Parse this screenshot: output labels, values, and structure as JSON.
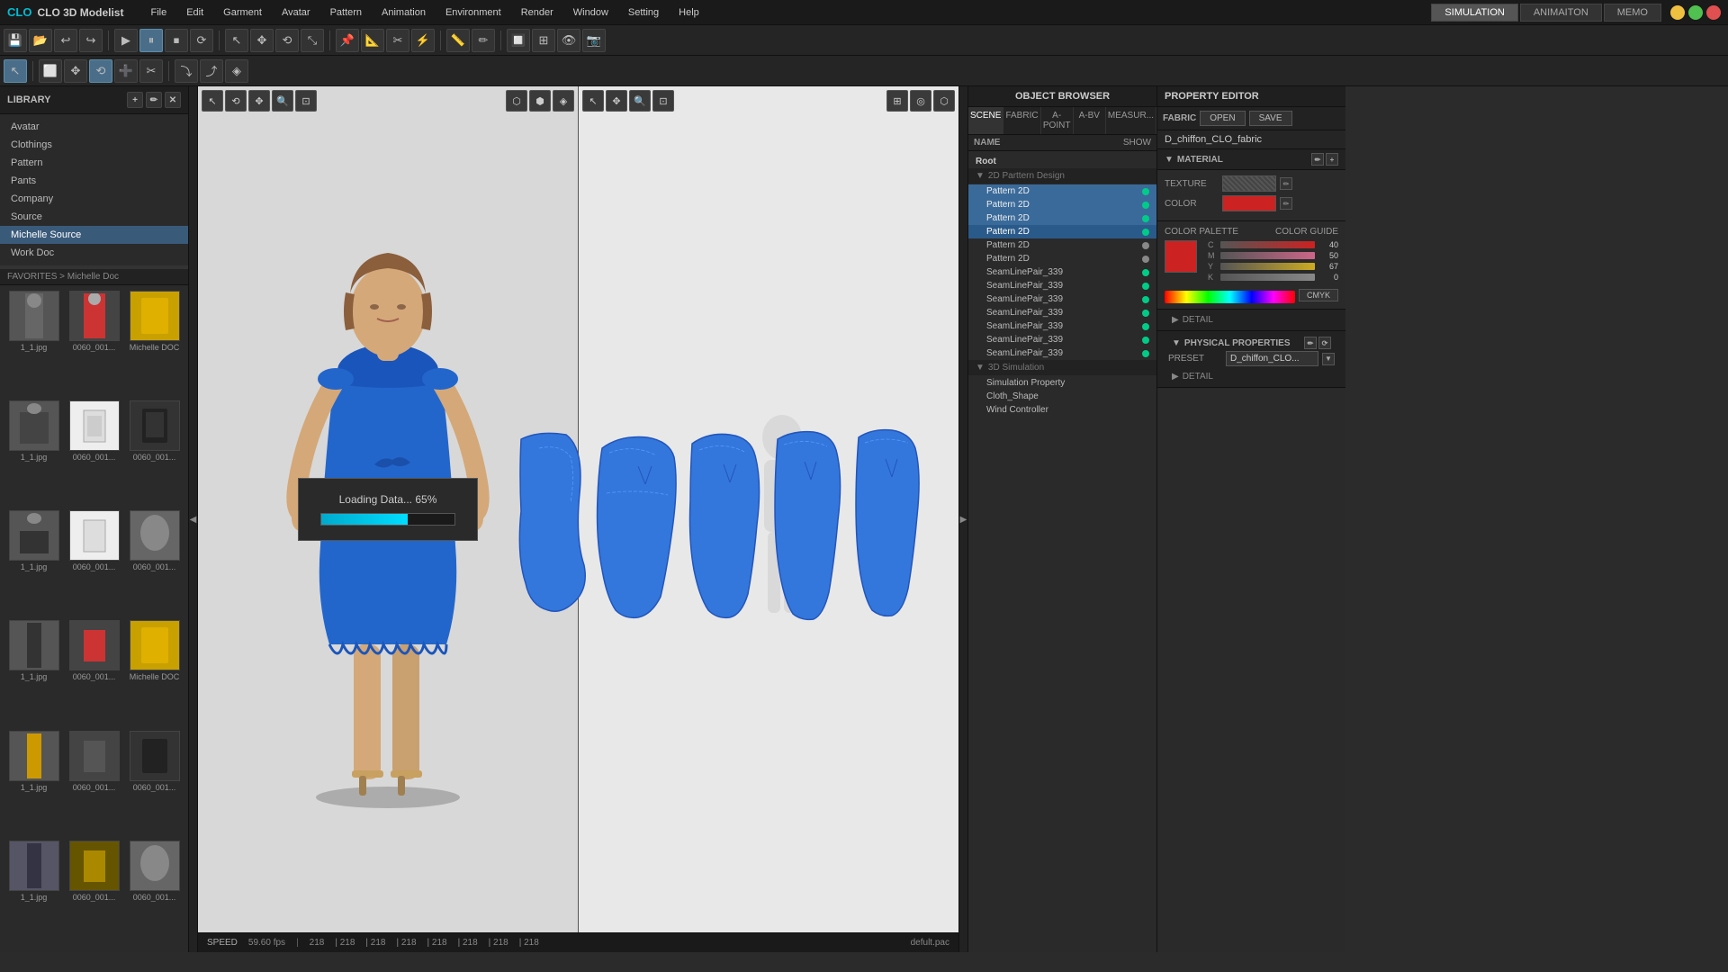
{
  "app": {
    "title": "CLO 3D Modelist",
    "logo": "CLO 3D Modelist"
  },
  "menu": {
    "items": [
      "File",
      "Edit",
      "Garment",
      "Avatar",
      "Pattern",
      "Animation",
      "Environment",
      "Render",
      "Window",
      "Setting",
      "Help"
    ]
  },
  "modes": {
    "simulation": "SIMULATION",
    "animation": "ANIMAITON",
    "memo": "MEMO"
  },
  "library": {
    "header": "LIBRARY",
    "nav_items": [
      "Avatar",
      "Clothings",
      "Pattern",
      "Pants",
      "Company",
      "Source",
      "Michelle Source",
      "Work Doc"
    ],
    "selected_item": "Michelle Source",
    "breadcrumb": "FAVORITES > Michelle Doc",
    "grid_items": [
      {
        "label": "1_1.jpg"
      },
      {
        "label": "0060_001..."
      },
      {
        "label": "Michelle DOC"
      },
      {
        "label": "1_1.jpg"
      },
      {
        "label": "0060_001..."
      },
      {
        "label": "0060_001..."
      },
      {
        "label": "1_1.jpg"
      },
      {
        "label": "0060_001..."
      },
      {
        "label": "0060_001..."
      },
      {
        "label": "1_1.jpg"
      },
      {
        "label": "0060_001..."
      },
      {
        "label": "Michelle DOC"
      },
      {
        "label": "1_1.jpg"
      },
      {
        "label": "0060_001..."
      },
      {
        "label": "0060_001..."
      },
      {
        "label": "1_1.jpg"
      },
      {
        "label": "0060_001..."
      },
      {
        "label": "0060_001..."
      }
    ]
  },
  "loading": {
    "text": "Loading Data... 65%",
    "progress": 65
  },
  "status_bar": {
    "speed_label": "SPEED",
    "speed_value": "59.60 fps",
    "coords": [
      "218",
      "218",
      "218",
      "218",
      "218",
      "218",
      "218",
      "218"
    ],
    "pac_name": "defult.pac"
  },
  "object_browser": {
    "header": "OBJECT BROWSER",
    "tabs": [
      "SCENE",
      "FABRIC",
      "A-POINT",
      "A-BV",
      "MEASUR..."
    ],
    "name_label": "NAME",
    "show_label": "SHOW",
    "tree": [
      {
        "label": "Root",
        "indent": 0,
        "type": "root"
      },
      {
        "label": "2D Parttern Design",
        "indent": 1,
        "type": "section"
      },
      {
        "label": "Pattern 2D",
        "indent": 2,
        "type": "item",
        "selected": true,
        "dot": true
      },
      {
        "label": "Pattern 2D",
        "indent": 2,
        "type": "item",
        "selected": true,
        "dot": true
      },
      {
        "label": "Pattern 2D",
        "indent": 2,
        "type": "item",
        "selected": true,
        "dot": true
      },
      {
        "label": "Pattern 2D",
        "indent": 2,
        "type": "item",
        "selected": true,
        "dot": true
      },
      {
        "label": "Pattern 2D",
        "indent": 2,
        "type": "item",
        "dot": false
      },
      {
        "label": "Pattern 2D",
        "indent": 2,
        "type": "item",
        "dot": false
      },
      {
        "label": "SeamLinePair_339",
        "indent": 2,
        "type": "item",
        "dot": true
      },
      {
        "label": "SeamLinePair_339",
        "indent": 2,
        "type": "item",
        "dot": true
      },
      {
        "label": "SeamLinePair_339",
        "indent": 2,
        "type": "item",
        "dot": true
      },
      {
        "label": "SeamLinePair_339",
        "indent": 2,
        "type": "item",
        "dot": true
      },
      {
        "label": "SeamLinePair_339",
        "indent": 2,
        "type": "item",
        "dot": true
      },
      {
        "label": "SeamLinePair_339",
        "indent": 2,
        "type": "item",
        "dot": true
      },
      {
        "label": "SeamLinePair_339",
        "indent": 2,
        "type": "item",
        "dot": true
      },
      {
        "label": "3D Simulation",
        "indent": 1,
        "type": "section"
      },
      {
        "label": "Simulation Property",
        "indent": 2,
        "type": "item"
      },
      {
        "label": "Cloth_Shape",
        "indent": 2,
        "type": "item"
      },
      {
        "label": "Wind Controller",
        "indent": 2,
        "type": "item"
      }
    ]
  },
  "property_editor": {
    "header": "PROPERTY EDITOR",
    "open_label": "OPEN",
    "save_label": "SAVE",
    "fabric_section": "FABRIC",
    "fabric_name": "D_chiffon_CLO_fabric",
    "material_section": "MATERIAL",
    "texture_label": "TEXTURE",
    "color_label": "COLOR",
    "color_palette_label": "COLOR PALETTE",
    "color_guide_label": "COLOR GUIDE",
    "cmyk": {
      "c_val": "40",
      "m_val": "50",
      "y_val": "67",
      "k_val": "0"
    },
    "cmyk_button": "CMYK",
    "detail_label": "DETAIL",
    "physical_label": "PHYSICAL PROPERTIES",
    "preset_label": "PRESET",
    "preset_value": "D_chiffon_CLO...",
    "detail2_label": "DETAIL"
  },
  "toolbar": {
    "save_icon": "💾",
    "open_icon": "📂",
    "undo_icon": "↩",
    "redo_icon": "↪"
  }
}
